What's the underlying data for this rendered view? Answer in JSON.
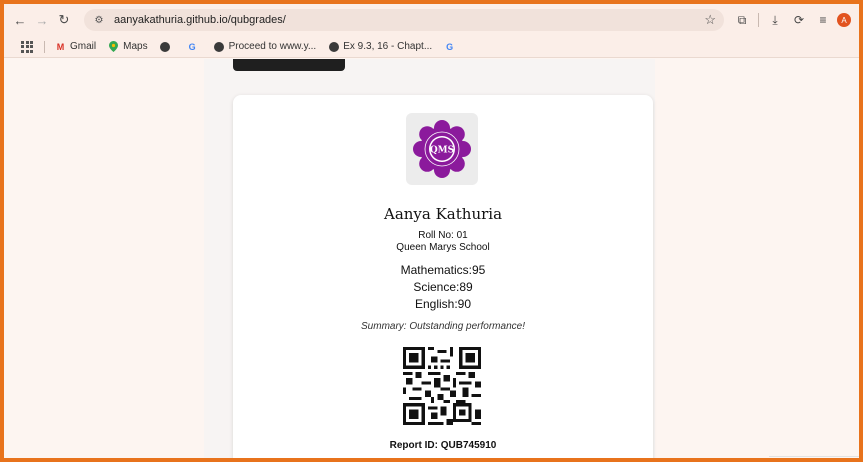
{
  "browser": {
    "url": "aanyakathuria.github.io/qubgrades/",
    "profile_initial": "A",
    "bookmarks": [
      {
        "label": "Gmail",
        "icon": "gmail-icon"
      },
      {
        "label": "Maps",
        "icon": "maps-icon"
      },
      {
        "label": "",
        "icon": "globe-icon"
      },
      {
        "label": "",
        "icon": "google-icon"
      },
      {
        "label": "Proceed to www.y...",
        "icon": "globe-icon"
      },
      {
        "label": "Ex 9.3, 16 - Chapt...",
        "icon": "globe-icon"
      },
      {
        "label": "",
        "icon": "google-icon"
      }
    ]
  },
  "report": {
    "name": "Aanya Kathuria",
    "roll": "Roll No: 01",
    "school": "Queen Marys School",
    "subjects": [
      "Mathematics:95",
      "Science:89",
      "English:90"
    ],
    "summary": "Summary: Outstanding performance!",
    "report_id": "Report ID: QUB745910"
  },
  "colors": {
    "accent": "#e8731c",
    "logo_purple": "#8b1a9c",
    "avatar": "#e2531f"
  }
}
